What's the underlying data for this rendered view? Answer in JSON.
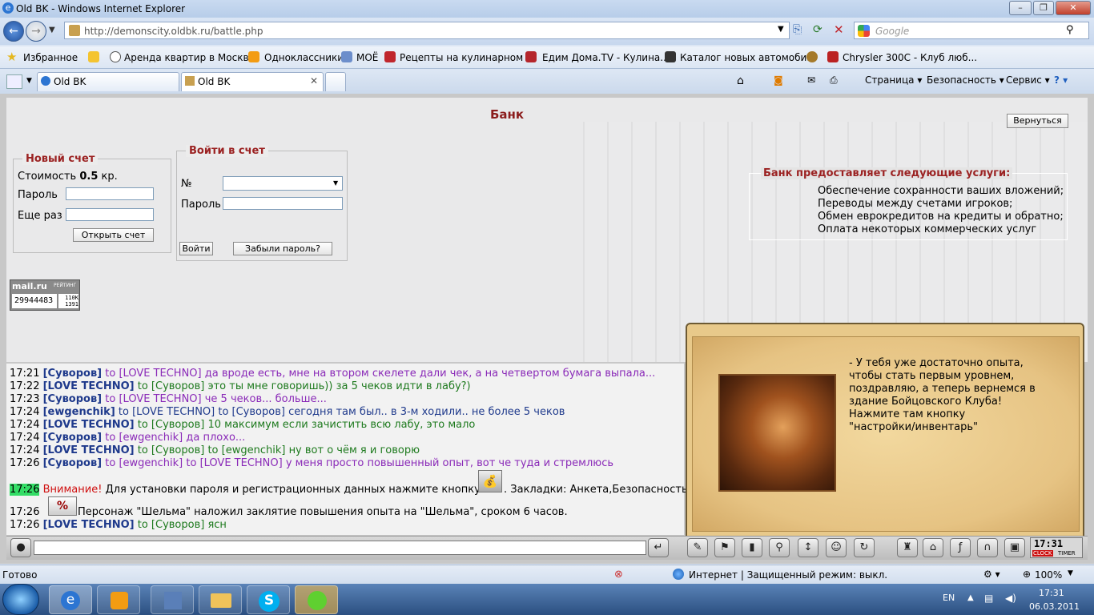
{
  "window": {
    "title": "Old BK - Windows Internet Explorer"
  },
  "address": {
    "url": "http://demonscity.oldbk.ru/battle.php",
    "search_placeholder": "Google"
  },
  "favorites": {
    "label": "Избранное",
    "items": [
      "Аренда квартир в Москв...",
      "Одноклассники",
      "МОЁ",
      "Рецепты на кулинарном ...",
      "Едим Дома.TV - Кулина...",
      "Каталог новых автомоби...",
      "Chrysler 300C - Клуб люб..."
    ]
  },
  "tabs": [
    {
      "label": "Old BK"
    },
    {
      "label": "Old BK"
    }
  ],
  "commandbar": {
    "page": "Страница",
    "safety": "Безопасность",
    "service": "Сервис"
  },
  "bank": {
    "title": "Банк",
    "back_button": "Вернуться",
    "new_account": {
      "legend": "Новый счет",
      "cost_label": "Стоимость",
      "cost_value": "0.5",
      "cost_unit": "кр.",
      "password_label": "Пароль",
      "repeat_label": "Еще раз",
      "open_button": "Открыть счет"
    },
    "login": {
      "legend": "Войти в счет",
      "number_label": "№",
      "password_label": "Пароль",
      "enter_button": "Войти",
      "forgot_button": "Забыли пароль?"
    },
    "services": {
      "header": "Банк предоставляет следующие услуги:",
      "items": [
        "Обеспечение сохранности ваших вложений;",
        "Переводы между счетами игроков;",
        "Обмен еврокредитов на кредиты и обратно;",
        "Оплата некоторых коммерческих услуг"
      ]
    },
    "counter": {
      "brand": "mail.ru",
      "sub": "РЕЙТИНГ",
      "value": "29944483",
      "v1": "110K",
      "v2": "1391"
    }
  },
  "chat": {
    "lines": [
      {
        "time": "17:21",
        "nick": "[Суворов]",
        "to": "to [LOVE TECHNO]",
        "msg": "да вроде есть, мне на втором скелете дали чек, а на четвертом бумага выпала...",
        "color": "purple"
      },
      {
        "time": "17:22",
        "nick": "[LOVE TECHNO]",
        "to": "to [Суворов]",
        "msg": "за 5 чеков идти в лабу?)",
        "color": "green",
        "to_full": "to [Суворов] это ты мне говоришь))"
      },
      {
        "time": "17:23",
        "nick": "[Суворов]",
        "to": "to [LOVE TECHNO]",
        "msg": "че 5 чеков... больше...",
        "color": "purple"
      },
      {
        "time": "17:24",
        "nick": "[ewgenchik]",
        "to": "to [LOVE TECHNO] to [Суворов]",
        "msg": "сегодня там был.. в 3-м ходили.. не более 5 чеков",
        "color": "blue"
      },
      {
        "time": "17:24",
        "nick": "[LOVE TECHNO]",
        "to": "to [Суворов]",
        "msg": "10 максимум если зачистить всю лабу, это мало",
        "color": "green"
      },
      {
        "time": "17:24",
        "nick": "[Суворов]",
        "to": "to [ewgenchik]",
        "msg": "да плохо...",
        "color": "purple"
      },
      {
        "time": "17:24",
        "nick": "[LOVE TECHNO]",
        "to": "to [Суворов] to [ewgenchik]",
        "msg": "ну вот о чём я и говорю",
        "color": "green"
      },
      {
        "time": "17:26",
        "nick": "[Суворов]",
        "to": "to [ewgenchik] to [LOVE TECHNO]",
        "msg": "у меня просто повышенный опыт, вот че туда и стремлюсь",
        "color": "purple"
      }
    ],
    "system1": {
      "time": "17:26",
      "warn": "Внимание!",
      "text": "Для установки пароля и регистрационных данных нажмите кнопку",
      "text2": ". Закладки: Анкета,Безопасность"
    },
    "system2": {
      "time": "17:26",
      "text": "Персонаж \"Шельма\" наложил заклятие повышения опыта на \"Шельма\", сроком 6 часов."
    },
    "last": {
      "time": "17:26",
      "nick": "[LOVE TECHNO]",
      "to": "to [Суворов]",
      "msg": "ясн"
    }
  },
  "scroll": {
    "lines": [
      "- У тебя уже достаточно опыта,",
      "чтобы стать первым уровнем,",
      "поздравляю, а теперь вернемся в",
      "здание Бойцовского Клуба!",
      "Нажмите там кнопку",
      "\"настройки/инвентарь\""
    ]
  },
  "clock": {
    "time": "17:31",
    "label1": "CLOCK",
    "label2": "TIMER"
  },
  "status": {
    "left": "Готово",
    "zone": "Интернет | Защищенный режим: выкл.",
    "zoom": "100%"
  },
  "taskbar": {
    "lang": "EN",
    "time": "17:31",
    "date": "06.03.2011"
  },
  "colors": {
    "bank_title": "#8b1c1c",
    "nick": "#1f3a8c",
    "purple": "#8a2ab8",
    "green": "#1e7a1e"
  }
}
